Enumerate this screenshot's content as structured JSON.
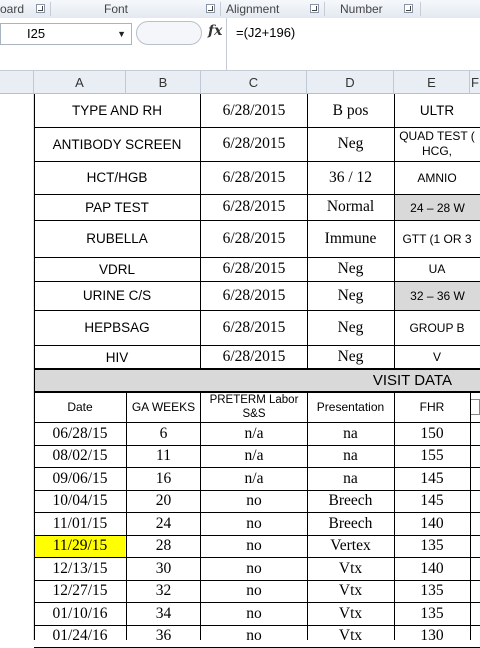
{
  "ribbon": {
    "groups": [
      {
        "label": "oard"
      },
      {
        "label": "Font"
      },
      {
        "label": "Alignment"
      },
      {
        "label": "Number"
      }
    ]
  },
  "formula_bar": {
    "name_box": "I25",
    "fx": "fx",
    "formula": "=(J2+196)"
  },
  "columns": [
    "A",
    "B",
    "C",
    "D",
    "E",
    "F"
  ],
  "labs": [
    {
      "test": "TYPE AND RH",
      "date": "6/28/2015",
      "result": "B pos",
      "f": "ULTR"
    },
    {
      "test": "ANTIBODY SCREEN",
      "date": "6/28/2015",
      "result": "Neg",
      "f": "QUAD TEST (",
      "f2": "HCG,"
    },
    {
      "test": "HCT/HGB",
      "date": "6/28/2015",
      "result": "36 / 12",
      "f": "AMNIO"
    },
    {
      "test": "PAP TEST",
      "date": "6/28/2015",
      "result": "Normal",
      "f": "24 – 28 W"
    },
    {
      "test": "RUBELLA",
      "date": "6/28/2015",
      "result": "Immune",
      "f": "GTT (1 OR 3"
    },
    {
      "test": "VDRL",
      "date": "6/28/2015",
      "result": "Neg",
      "f": "UA"
    },
    {
      "test": "URINE C/S",
      "date": "6/28/2015",
      "result": "Neg",
      "f": "32 – 36 W"
    },
    {
      "test": "HEPBSAG",
      "date": "6/28/2015",
      "result": "Neg",
      "f": "GROUP B"
    },
    {
      "test": "HIV",
      "date": "6/28/2015",
      "result": "Neg",
      "f": "V"
    }
  ],
  "visit": {
    "title": "VISIT DATA",
    "headers": {
      "date": "Date",
      "ga": "GA WEEKS",
      "preterm": "PRETERM Labor S&S",
      "presentation": "Presentation",
      "fhr": "FHR"
    },
    "highlight_color": "#ffff00",
    "rows": [
      {
        "date": "06/28/15",
        "ga": "6",
        "preterm": "n/a",
        "presentation": "na",
        "fhr": "150"
      },
      {
        "date": "08/02/15",
        "ga": "11",
        "preterm": "n/a",
        "presentation": "na",
        "fhr": "155"
      },
      {
        "date": "09/06/15",
        "ga": "16",
        "preterm": "n/a",
        "presentation": "na",
        "fhr": "145"
      },
      {
        "date": "10/04/15",
        "ga": "20",
        "preterm": "no",
        "presentation": "Breech",
        "fhr": "145"
      },
      {
        "date": "11/01/15",
        "ga": "24",
        "preterm": "no",
        "presentation": "Breech",
        "fhr": "140"
      },
      {
        "date": "11/29/15",
        "ga": "28",
        "preterm": "no",
        "presentation": "Vertex",
        "fhr": "135",
        "highlight": true
      },
      {
        "date": "12/13/15",
        "ga": "30",
        "preterm": "no",
        "presentation": "Vtx",
        "fhr": "140"
      },
      {
        "date": "12/27/15",
        "ga": "32",
        "preterm": "no",
        "presentation": "Vtx",
        "fhr": "135"
      },
      {
        "date": "01/10/16",
        "ga": "34",
        "preterm": "no",
        "presentation": "Vtx",
        "fhr": "135"
      },
      {
        "date": "01/24/16",
        "ga": "36",
        "preterm": "no",
        "presentation": "Vtx",
        "fhr": "130"
      }
    ]
  }
}
